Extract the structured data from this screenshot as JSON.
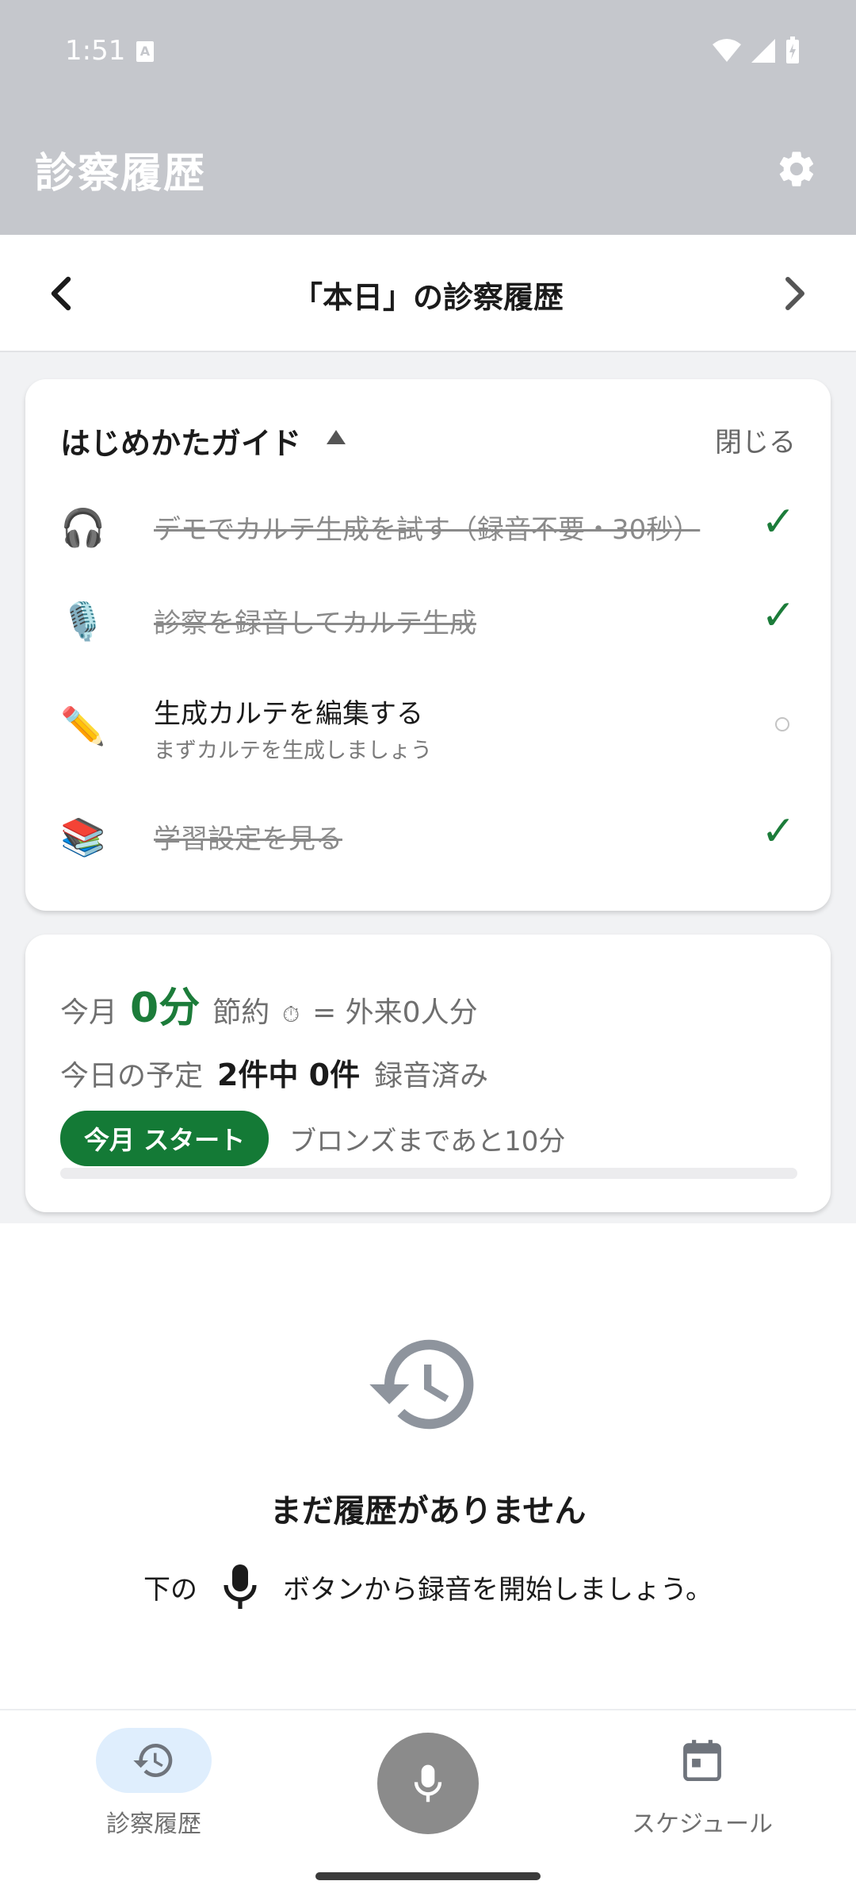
{
  "status_bar": {
    "time": "1:51",
    "badge": "A"
  },
  "app_bar": {
    "title": "診察履歴",
    "settings_icon": "gear-icon"
  },
  "date_header": {
    "title": "「本日」の診察履歴"
  },
  "guide": {
    "title": "はじめかたガイド",
    "close_label": "閉じる",
    "items": [
      {
        "emoji": "🎧",
        "label": "デモでカルテ生成を試す（録音不要・30秒）",
        "done": true,
        "check": "✓"
      },
      {
        "emoji": "🎙️",
        "label": "診察を録音してカルテ生成",
        "done": true,
        "check": "✓"
      },
      {
        "emoji": "✏️",
        "label": "生成カルテを編集する",
        "sublabel": "まずカルテを生成しましょう",
        "done": false
      },
      {
        "emoji": "📚",
        "label": "学習設定を見る",
        "done": true,
        "check": "✓"
      }
    ]
  },
  "stats": {
    "month_label": "今月",
    "saved_value": "0分",
    "saved_label": "節約",
    "timer_icon": "⏱",
    "equivalent": "= 外来0人分",
    "today_label": "今日の予定",
    "today_count": "2件中 0件",
    "recorded_label": "録音済み",
    "badge_label": "今月 スタート",
    "next_rank_text": "ブロンズまであと10分",
    "progress": 0
  },
  "empty_state": {
    "title": "まだ履歴がありません",
    "hint_before": "下の",
    "hint_after": "ボタンから録音を開始しましょう。"
  },
  "bottom_nav": {
    "history_label": "診察履歴",
    "schedule_label": "スケジュール"
  },
  "colors": {
    "accent_green": "#147a36",
    "check_green": "#1c7c3a",
    "active_tab_bg": "#dfeefd",
    "scrim": "#c5c7cc"
  }
}
